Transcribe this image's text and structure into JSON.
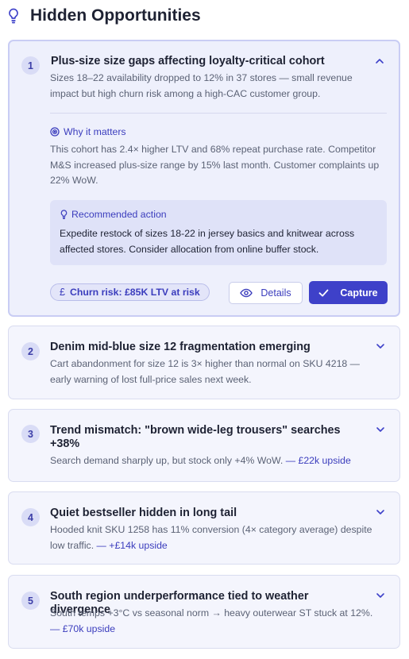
{
  "header": {
    "title": "Hidden Opportunities",
    "icon": "lightbulb-icon"
  },
  "colors": {
    "accent": "#3e41c9",
    "card_bg": "#f4f5fd",
    "expanded_bg": "#eef0fc"
  },
  "opportunities": [
    {
      "number": "1",
      "title": "Plus-size size gaps affecting loyalty-critical cohort",
      "description": "Sizes 18–22 availability dropped to 12% in 37 stores — small revenue impact but high churn risk among a high-CAC customer group.",
      "why_label": "Why it matters",
      "why_text": "This cohort has 2.4× higher LTV and 68% repeat purchase rate. Competitor M&S increased plus-size range by 15% last month. Customer complaints up 22% WoW.",
      "rec_label": "Recommended action",
      "rec_text": "Expedite restock of sizes 18-22 in jersey basics and knitwear across affected stores. Consider allocation from online buffer stock.",
      "risk_symbol": "£",
      "risk_label": "Churn risk: £85K LTV at risk",
      "details_label": "Details",
      "capture_label": "Capture"
    },
    {
      "number": "2",
      "title": "Denim mid-blue size 12 fragmentation emerging",
      "description": "Cart abandonment for size 12 is 3× higher than normal on SKU 4218 — early warning of lost full-price sales next week.",
      "upside": ""
    },
    {
      "number": "3",
      "title": "Trend mismatch: \"brown wide-leg trousers\" searches +38%",
      "description": "Search demand sharply up, but stock only +4% WoW. ",
      "upside": "— £22k upside"
    },
    {
      "number": "4",
      "title": "Quiet bestseller hidden in long tail",
      "description": "Hooded knit SKU 1258 has 11% conversion (4× category average) despite low traffic. ",
      "upside": "— +£14k upside"
    },
    {
      "number": "5",
      "title": "South region underperformance tied to weather divergence",
      "description": "South temps +3°C vs seasonal norm → heavy outerwear ST stuck at 12%. ",
      "upside": "— £70k upside"
    }
  ]
}
